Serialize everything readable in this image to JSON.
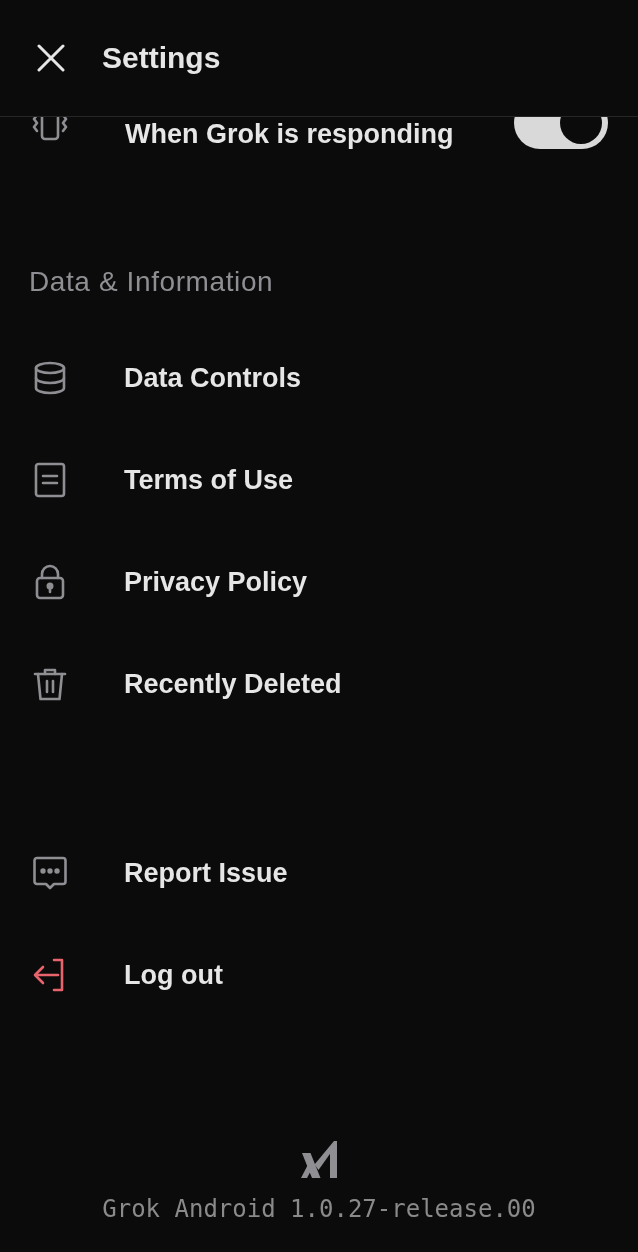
{
  "header": {
    "title": "Settings"
  },
  "partial_row": {
    "label": "When Grok is responding",
    "kind": "vibration",
    "on": true
  },
  "sections": [
    {
      "title": "Data & Information",
      "items": [
        {
          "label": "Data Controls",
          "kind": "database"
        },
        {
          "label": "Terms of Use",
          "kind": "document"
        },
        {
          "label": "Privacy Policy",
          "kind": "lock"
        },
        {
          "label": "Recently Deleted",
          "kind": "trash"
        }
      ]
    },
    {
      "items": [
        {
          "label": "Report Issue",
          "kind": "report"
        },
        {
          "label": "Log out",
          "kind": "logout"
        }
      ]
    }
  ],
  "footer": {
    "version": "Grok Android 1.0.27-release.00"
  }
}
